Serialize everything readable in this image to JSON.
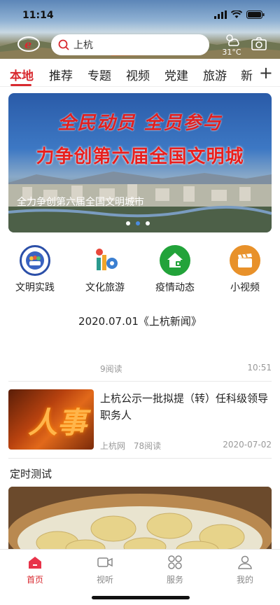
{
  "status": {
    "time": "11:14"
  },
  "search": {
    "text": "上杭"
  },
  "weather": {
    "temp": "31°C"
  },
  "tabs": [
    "本地",
    "推荐",
    "专题",
    "视频",
    "党建",
    "旅游",
    "新"
  ],
  "banner": {
    "line1": "全民动员 全员参与",
    "line2": "力争创第六届全国文明城",
    "caption": "全力争创第六届全国文明城市"
  },
  "quick": [
    {
      "label": "文明实践",
      "icon": "civilization-practice-icon",
      "color": "#2b4fa8"
    },
    {
      "label": "文化旅游",
      "icon": "culture-tourism-icon",
      "color": "#f0f0f0"
    },
    {
      "label": "疫情动态",
      "icon": "epidemic-home-icon",
      "color": "#22a33a"
    },
    {
      "label": "小视频",
      "icon": "clapperboard-icon",
      "color": "#e8912a"
    }
  ],
  "news1": {
    "title": "2020.07.01《上杭新闻》",
    "reads": "9阅读",
    "time": "10:51"
  },
  "news2": {
    "title": "上杭公示一批拟提（转）任科级领导职务人",
    "source": "上杭网",
    "reads": "78阅读",
    "date": "2020-07-02",
    "image_text": "人事"
  },
  "section": {
    "title": "定时测试"
  },
  "bottomnav": [
    {
      "label": "首页",
      "icon": "home-icon"
    },
    {
      "label": "视听",
      "icon": "video-icon"
    },
    {
      "label": "服务",
      "icon": "grid-icon"
    },
    {
      "label": "我的",
      "icon": "user-icon"
    }
  ],
  "colors": {
    "accent": "#d8292f"
  }
}
